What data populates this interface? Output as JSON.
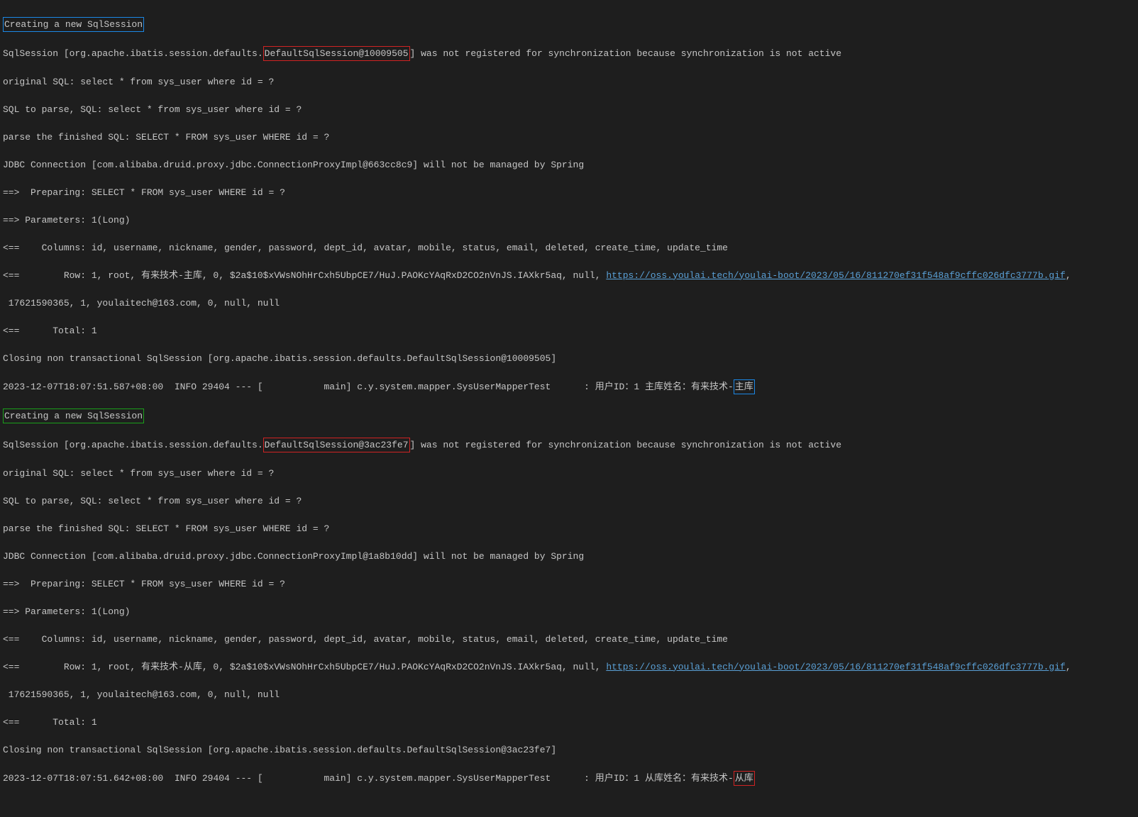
{
  "session1": {
    "create": "Creating a new SqlSession",
    "pre": "SqlSession [org.apache.ibatis.session.defaults.",
    "id": "DefaultSqlSession@10009505",
    "post": "] was not registered for synchronization because synchronization is not active",
    "origSql": "original SQL: select * from sys_user where id = ?",
    "toParse": "SQL to parse, SQL: select * from sys_user where id = ?",
    "parsed": "parse the finished SQL: SELECT * FROM sys_user WHERE id = ?",
    "jdbc": "JDBC Connection [com.alibaba.druid.proxy.jdbc.ConnectionProxyImpl@663cc8c9] will not be managed by Spring",
    "prep": "==>  Preparing: SELECT * FROM sys_user WHERE id = ?",
    "params": "==> Parameters: 1(Long)",
    "cols": "<==    Columns: id, username, nickname, gender, password, dept_id, avatar, mobile, status, email, deleted, create_time, update_time",
    "rowPre": "<==        Row: 1, root, 有来技术-主库, 0, $2a$10$xVWsNOhHrCxh5UbpCE7/HuJ.PAOKcYAqRxD2CO2nVnJS.IAXkr5aq, null, ",
    "link": "https://oss.youlai.tech/youlai-boot/2023/05/16/811270ef31f548af9cffc026dfc3777b.gif",
    "rowPost": ",",
    "rowCont": " 17621590365, 1, youlaitech@163.com, 0, null, null",
    "total": "<==      Total: 1",
    "closing": "Closing non transactional SqlSession [org.apache.ibatis.session.defaults.DefaultSqlSession@10009505]",
    "ts": "2023-12-07T18:07:51.587+08:00  INFO 29404 --- [           main] c.y.system.mapper.SysUserMapperTest      : 用户ID：1 主库姓名：有来技术-",
    "badge": "主库"
  },
  "session2": {
    "create": "Creating a new SqlSession",
    "pre": "SqlSession [org.apache.ibatis.session.defaults.",
    "id": "DefaultSqlSession@3ac23fe7",
    "post": "] was not registered for synchronization because synchronization is not active",
    "origSql": "original SQL: select * from sys_user where id = ?",
    "toParse": "SQL to parse, SQL: select * from sys_user where id = ?",
    "parsed": "parse the finished SQL: SELECT * FROM sys_user WHERE id = ?",
    "jdbc": "JDBC Connection [com.alibaba.druid.proxy.jdbc.ConnectionProxyImpl@1a8b10dd] will not be managed by Spring",
    "prep": "==>  Preparing: SELECT * FROM sys_user WHERE id = ?",
    "params": "==> Parameters: 1(Long)",
    "cols": "<==    Columns: id, username, nickname, gender, password, dept_id, avatar, mobile, status, email, deleted, create_time, update_time",
    "rowPre": "<==        Row: 1, root, 有来技术-从库, 0, $2a$10$xVWsNOhHrCxh5UbpCE7/HuJ.PAOKcYAqRxD2CO2nVnJS.IAXkr5aq, null, ",
    "link": "https://oss.youlai.tech/youlai-boot/2023/05/16/811270ef31f548af9cffc026dfc3777b.gif",
    "rowPost": ",",
    "rowCont": " 17621590365, 1, youlaitech@163.com, 0, null, null",
    "total": "<==      Total: 1",
    "closing": "Closing non transactional SqlSession [org.apache.ibatis.session.defaults.DefaultSqlSession@3ac23fe7]",
    "ts": "2023-12-07T18:07:51.642+08:00  INFO 29404 --- [           main] c.y.system.mapper.SysUserMapperTest      : 用户ID：1 从库姓名：有来技术-",
    "badge": "从库"
  }
}
